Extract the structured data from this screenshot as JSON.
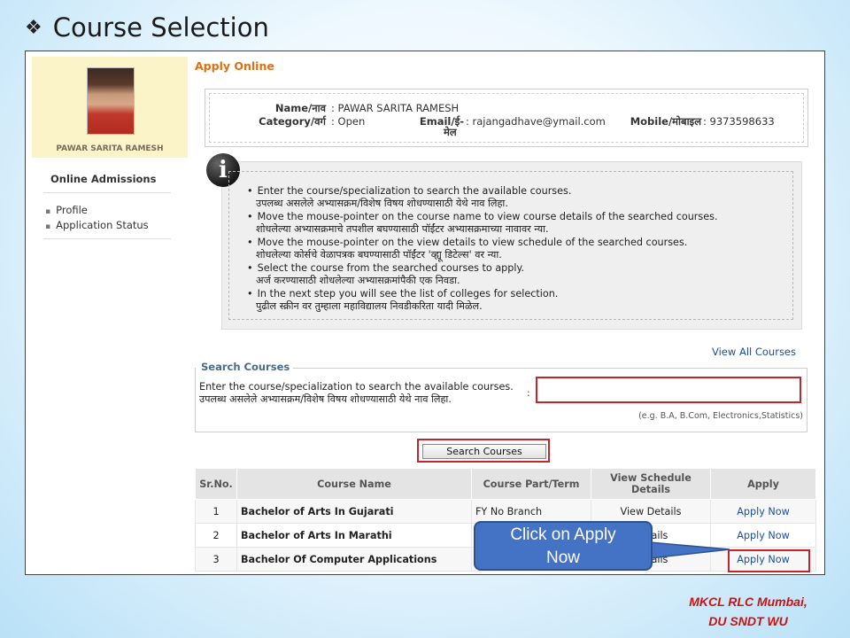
{
  "slide": {
    "bullet_glyph": "❖",
    "title": "Course Selection",
    "footer_line1": "MKCL RLC Mumbai,",
    "footer_line2": "DU SNDT WU"
  },
  "sidebar": {
    "student_name": "PAWAR SARITA RAMESH",
    "section_title": "Online Admissions",
    "links": [
      {
        "label": "Profile"
      },
      {
        "label": "Application Status"
      }
    ]
  },
  "main": {
    "page_heading": "Apply Online",
    "applicant": {
      "name_label": "Name/नाव",
      "name_value": ": PAWAR SARITA RAMESH",
      "category_label": "Category/वर्ग",
      "category_value": ": Open",
      "email_label": "Email/ई-",
      "email_label_line2": "मेल",
      "email_value": ": rajangadhave@ymail.com",
      "mobile_label": "Mobile/मोबाइल",
      "mobile_value": ": 9373598633"
    },
    "instructions": [
      {
        "en": "Enter the course/specialization to search the available courses.",
        "mr": "उपलब्ध असलेले अभ्यासक्रम/विशेष विषय शोधण्यासाठी येथे नाव लिहा."
      },
      {
        "en": "Move the mouse-pointer on the course name to view course details of the searched courses.",
        "mr": "शोधलेल्या अभ्यासक्रमाचे तपशील बघण्यासाठी पॉईंटर अभ्यासक्रमाच्या नावावर न्या."
      },
      {
        "en": "Move the mouse-pointer on the view details to view schedule of the searched courses.",
        "mr": "शोधलेल्या कोर्सचे वेळापत्रक बघण्यासाठी पॉईंटर 'व्ह्यू डिटेल्स' वर न्या."
      },
      {
        "en": "Select the course from the searched courses to apply.",
        "mr": "अर्ज करण्यासाठी शोधलेल्या अभ्यासक्रमांपैकी एक निवडा."
      },
      {
        "en": "In the next step you will see the list of colleges for selection.",
        "mr": "पुढील स्क्रीन वर तुम्हाला महाविद्यालय निवडीकरिता यादी मिळेल."
      }
    ],
    "info_icon_glyph": "i",
    "view_all_courses": "View All Courses",
    "search": {
      "legend": "Search Courses",
      "prompt_en": "Enter the course/specialization to search the available courses.",
      "prompt_mr": "उपलब्ध असलेले अभ्यासक्रम/विशेष विषय शोधण्यासाठी येथे नाव लिहा.",
      "colon": ":",
      "input_value": "",
      "hint": "(e.g. B.A, B.Com, Electronics,Statistics)",
      "button_label": "Search Courses"
    },
    "table": {
      "headers": [
        "Sr.No.",
        "Course Name",
        "Course Part/Term",
        "View Schedule Details",
        "Apply"
      ],
      "rows": [
        {
          "sr": "1",
          "course": "Bachelor of Arts In Gujarati",
          "part": "FY No Branch",
          "details": "View Details",
          "apply": "Apply Now"
        },
        {
          "sr": "2",
          "course": "Bachelor of Arts In Marathi",
          "part": "",
          "details": "Details",
          "apply": "Apply Now"
        },
        {
          "sr": "3",
          "course": "Bachelor Of Computer Applications",
          "part": "",
          "details": "Details",
          "apply": "Apply Now"
        }
      ]
    }
  },
  "callout": {
    "line1": "Click on Apply",
    "line2": "Now"
  }
}
